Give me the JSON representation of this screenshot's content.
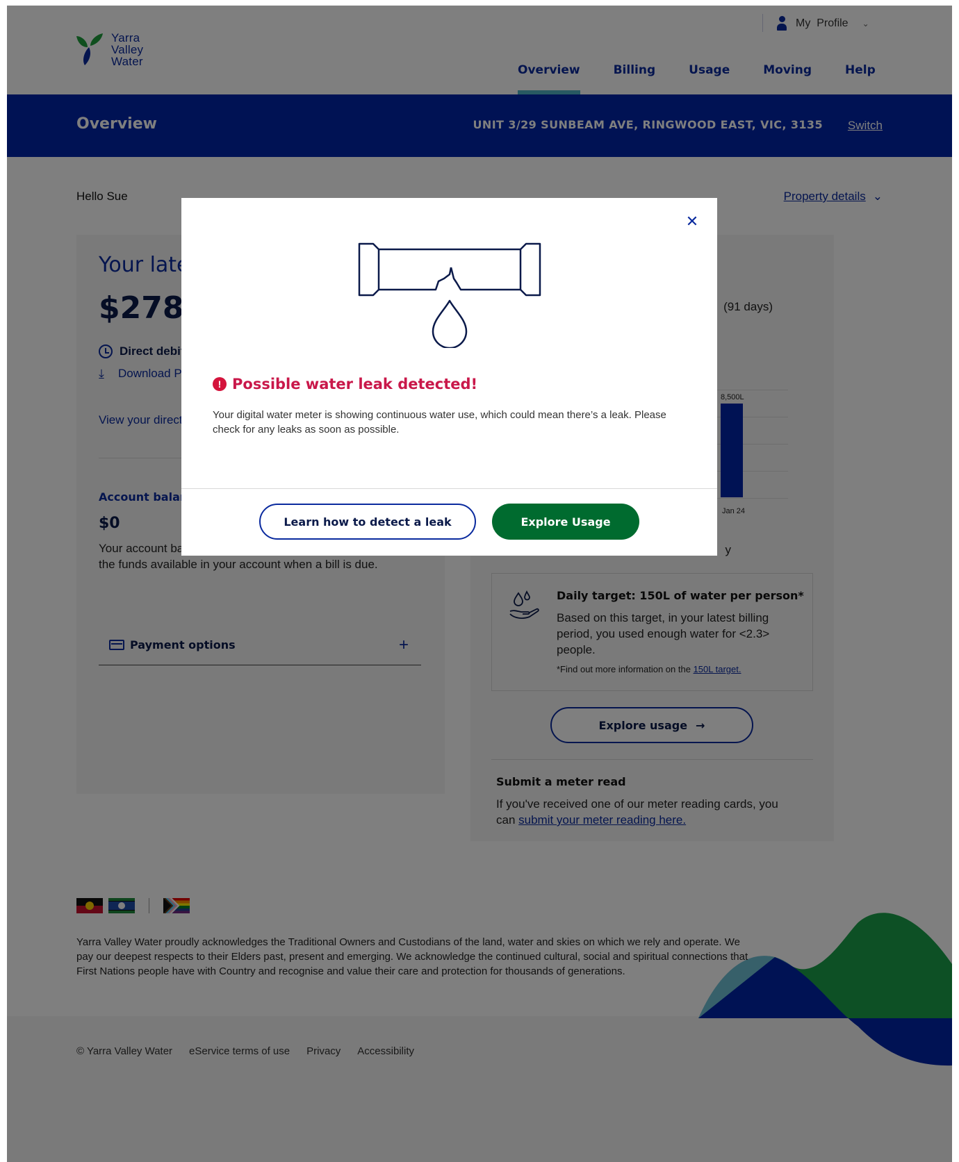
{
  "header": {
    "logo": {
      "line1": "Yarra",
      "line2": "Valley",
      "line3": "Water"
    },
    "profile_label": "My  Profile",
    "nav": [
      {
        "label": "Overview"
      },
      {
        "label": "Billing"
      },
      {
        "label": "Usage"
      },
      {
        "label": "Moving"
      },
      {
        "label": "Help"
      }
    ],
    "active_nav": "Overview"
  },
  "banner": {
    "title": "Overview",
    "address": "UNIT 3/29 SUNBEAM AVE, RINGWOOD EAST, VIC, 3135",
    "switch_label": "Switch"
  },
  "greeting": "Hello Sue",
  "property_details_label": "Property details",
  "bill_card": {
    "title": "Your latest bill",
    "amount": "$278.45",
    "direct_debit": "Direct debit",
    "download": "Download PDF",
    "view_direct_debit": "View your direct debit",
    "account_balance_label": "Account balance",
    "account_balance_value": "$0",
    "account_balance_text": "Your account balance is up to date. Please ensure you have the funds available in your account when a bill is due.",
    "payment_options_label": "Payment options"
  },
  "usage_card": {
    "period_days": "(91 days)",
    "bar_label": "8,500L",
    "bar_x_label": "Jan 24",
    "trailing_text": "y",
    "target": {
      "title": "Daily target: 150L of water per person*",
      "text": "Based on this target, in your latest billing period, you used enough water for <2.3> people.",
      "note_prefix": "*Find out more information on the ",
      "note_link": "150L target."
    },
    "explore_usage_label": "Explore usage",
    "meter_title": "Submit a meter read",
    "meter_text_prefix": "If you've received one of our meter reading cards, you can ",
    "meter_link": "submit your meter reading here."
  },
  "footer": {
    "acknowledgement": "Yarra Valley Water proudly acknowledges the Traditional Owners and Custodians of the land, water and skies on which we rely and operate. We pay our deepest respects to their Elders past, present and emerging. We acknowledge the continued cultural, social and spiritual connections that First Nations people have with Country and recognise and value their care and protection for thousands of generations.",
    "links": [
      {
        "label": "© Yarra Valley Water"
      },
      {
        "label": "eService terms of use"
      },
      {
        "label": "Privacy"
      },
      {
        "label": "Accessibility"
      }
    ]
  },
  "modal": {
    "title": "Possible water leak detected!",
    "body": "Your digital water meter is showing continuous water use, which could mean there’s a leak. Please check for any leaks as soon as possible.",
    "secondary_button": "Learn how to detect a leak",
    "primary_button": "Explore Usage",
    "close_icon": "close-icon",
    "illustration": "leaking-pipe-icon"
  },
  "colors": {
    "brand_blue": "#0024a8",
    "accent_teal": "#51b3c4",
    "brand_green": "#006b2f",
    "alert_red": "#c9184a"
  }
}
